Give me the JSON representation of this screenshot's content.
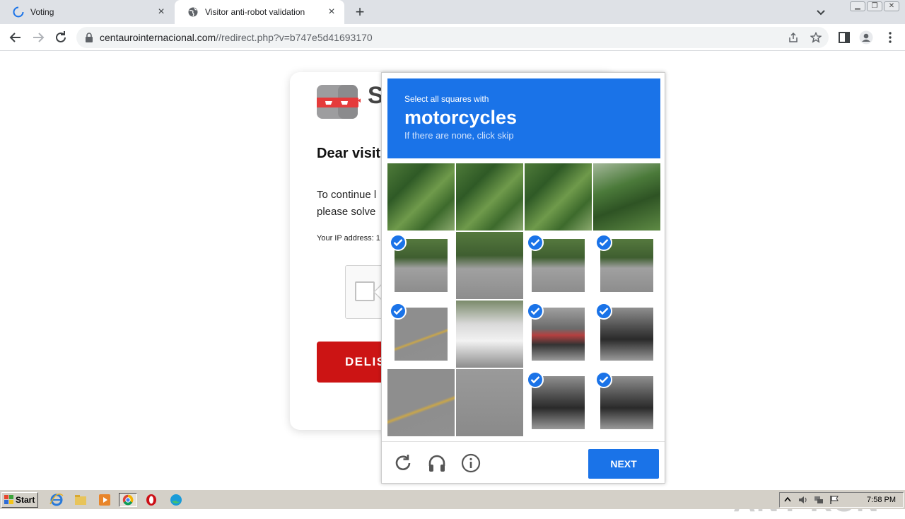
{
  "browser": {
    "tabs": [
      {
        "title": "Voting",
        "loading": true
      },
      {
        "title": "Visitor anti-robot validation",
        "active": true
      }
    ],
    "url_host": "centaurointernacional.com",
    "url_path": "//redirect.php?v=b747e5d41693170"
  },
  "page": {
    "greeting": "Dear visit",
    "paragraph_line1": "To continue l",
    "paragraph_line2": "please solve",
    "ip_label": "Your IP address: 1",
    "button_label": "DELIS",
    "logo_letter": "S"
  },
  "captcha": {
    "instruction": "Select all squares with",
    "target": "motorcycles",
    "hint": "If there are none, click skip",
    "next_label": "NEXT",
    "tiles": [
      {
        "selected": false,
        "scene": "tree"
      },
      {
        "selected": false,
        "scene": "tree"
      },
      {
        "selected": false,
        "scene": "tree"
      },
      {
        "selected": false,
        "scene": "tree2"
      },
      {
        "selected": true,
        "scene": "street"
      },
      {
        "selected": false,
        "scene": "street"
      },
      {
        "selected": true,
        "scene": "street"
      },
      {
        "selected": true,
        "scene": "street"
      },
      {
        "selected": true,
        "scene": "roadline"
      },
      {
        "selected": false,
        "scene": "car"
      },
      {
        "selected": true,
        "scene": "moto2"
      },
      {
        "selected": true,
        "scene": "moto"
      },
      {
        "selected": false,
        "scene": "roadline"
      },
      {
        "selected": false,
        "scene": "road"
      },
      {
        "selected": true,
        "scene": "moto"
      },
      {
        "selected": true,
        "scene": "moto"
      }
    ],
    "footer_icons": [
      "reload-icon",
      "audio-icon",
      "info-icon"
    ]
  },
  "watermark": "ANY RUN",
  "taskbar": {
    "start_label": "Start",
    "clock": "7:58 PM",
    "apps": [
      "ie-icon",
      "explorer-icon",
      "media-player-icon",
      "chrome-icon",
      "opera-icon",
      "edge-icon"
    ]
  },
  "colors": {
    "accent_blue": "#1a73e8",
    "delist_red": "#cc1414"
  }
}
